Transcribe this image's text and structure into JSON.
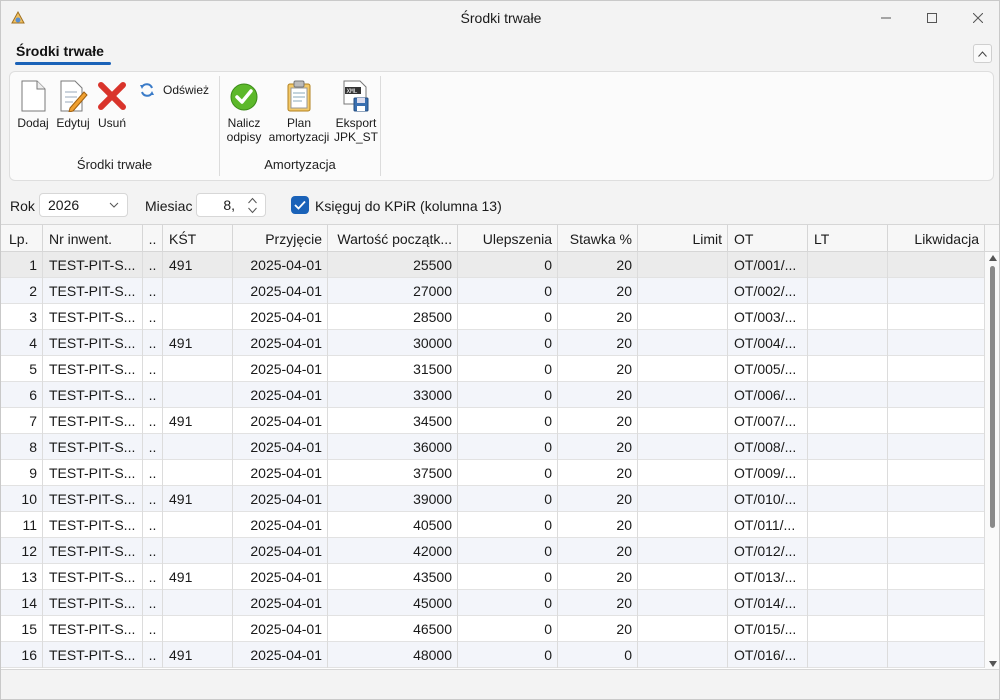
{
  "window": {
    "title": "Środki trwałe",
    "minimize": "—",
    "maximize": "☐",
    "close": "✕"
  },
  "ribbon_tab": {
    "label": "Środki trwałe",
    "collapse": "^"
  },
  "ribbon": {
    "groups": [
      {
        "label": "Środki trwałe",
        "buttons": [
          {
            "label": "Dodaj",
            "icon": "document-icon"
          },
          {
            "label": "Edytuj",
            "icon": "edit-document-icon"
          },
          {
            "label": "Usuń",
            "icon": "delete-x-icon"
          },
          {
            "label": "Odśwież",
            "icon": "refresh-icon"
          }
        ]
      },
      {
        "label": "Amortyzacja",
        "buttons": [
          {
            "label": "Nalicz odpisy",
            "line1": "Nalicz",
            "line2": "odpisy",
            "icon": "checkmark-icon"
          },
          {
            "label": "Plan amortyzacji",
            "line1": "Plan",
            "line2": "amortyzacji",
            "icon": "clipboard-icon"
          },
          {
            "label": "Eksport JPK_ST",
            "line1": "Eksport",
            "line2": "JPK_ST",
            "icon": "xml-export-icon"
          }
        ]
      }
    ]
  },
  "filter": {
    "year_label": "Rok",
    "year_value": "2026",
    "month_label": "Miesiac",
    "month_value": "8,",
    "kpir_checkbox": {
      "label": "Księguj do KPiR (kolumna 13)",
      "checked": true
    }
  },
  "table": {
    "columns": [
      "Lp.",
      "Nr inwent.",
      "..",
      "KŚT",
      "Przyjęcie",
      "Wartość początk...",
      "Ulepszenia",
      "Stawka %",
      "Limit",
      "OT",
      "LT",
      "Likwidacja"
    ],
    "rows": [
      [
        "1",
        "TEST-PIT-S...",
        "..",
        "491",
        "2025-04-01",
        "25500",
        "0",
        "20",
        "",
        "OT/001/...",
        "",
        ""
      ],
      [
        "2",
        "TEST-PIT-S...",
        "..",
        "",
        "2025-04-01",
        "27000",
        "0",
        "20",
        "",
        "OT/002/...",
        "",
        ""
      ],
      [
        "3",
        "TEST-PIT-S...",
        "..",
        "",
        "2025-04-01",
        "28500",
        "0",
        "20",
        "",
        "OT/003/...",
        "",
        ""
      ],
      [
        "4",
        "TEST-PIT-S...",
        "..",
        "491",
        "2025-04-01",
        "30000",
        "0",
        "20",
        "",
        "OT/004/...",
        "",
        ""
      ],
      [
        "5",
        "TEST-PIT-S...",
        "..",
        "",
        "2025-04-01",
        "31500",
        "0",
        "20",
        "",
        "OT/005/...",
        "",
        ""
      ],
      [
        "6",
        "TEST-PIT-S...",
        "..",
        "",
        "2025-04-01",
        "33000",
        "0",
        "20",
        "",
        "OT/006/...",
        "",
        ""
      ],
      [
        "7",
        "TEST-PIT-S...",
        "..",
        "491",
        "2025-04-01",
        "34500",
        "0",
        "20",
        "",
        "OT/007/...",
        "",
        ""
      ],
      [
        "8",
        "TEST-PIT-S...",
        "..",
        "",
        "2025-04-01",
        "36000",
        "0",
        "20",
        "",
        "OT/008/...",
        "",
        ""
      ],
      [
        "9",
        "TEST-PIT-S...",
        "..",
        "",
        "2025-04-01",
        "37500",
        "0",
        "20",
        "",
        "OT/009/...",
        "",
        ""
      ],
      [
        "10",
        "TEST-PIT-S...",
        "..",
        "491",
        "2025-04-01",
        "39000",
        "0",
        "20",
        "",
        "OT/010/...",
        "",
        ""
      ],
      [
        "11",
        "TEST-PIT-S...",
        "..",
        "",
        "2025-04-01",
        "40500",
        "0",
        "20",
        "",
        "OT/011/...",
        "",
        ""
      ],
      [
        "12",
        "TEST-PIT-S...",
        "..",
        "",
        "2025-04-01",
        "42000",
        "0",
        "20",
        "",
        "OT/012/...",
        "",
        ""
      ],
      [
        "13",
        "TEST-PIT-S...",
        "..",
        "491",
        "2025-04-01",
        "43500",
        "0",
        "20",
        "",
        "OT/013/...",
        "",
        ""
      ],
      [
        "14",
        "TEST-PIT-S...",
        "..",
        "",
        "2025-04-01",
        "45000",
        "0",
        "20",
        "",
        "OT/014/...",
        "",
        ""
      ],
      [
        "15",
        "TEST-PIT-S...",
        "..",
        "",
        "2025-04-01",
        "46500",
        "0",
        "20",
        "",
        "OT/015/...",
        "",
        ""
      ],
      [
        "16",
        "TEST-PIT-S...",
        "..",
        "491",
        "2025-04-01",
        "48000",
        "0",
        "0",
        "",
        "OT/016/...",
        "",
        ""
      ]
    ]
  },
  "colors": {
    "accent": "#1a62b8",
    "alt_row": "#f3f5fa",
    "selected_row": "#ebebeb"
  }
}
